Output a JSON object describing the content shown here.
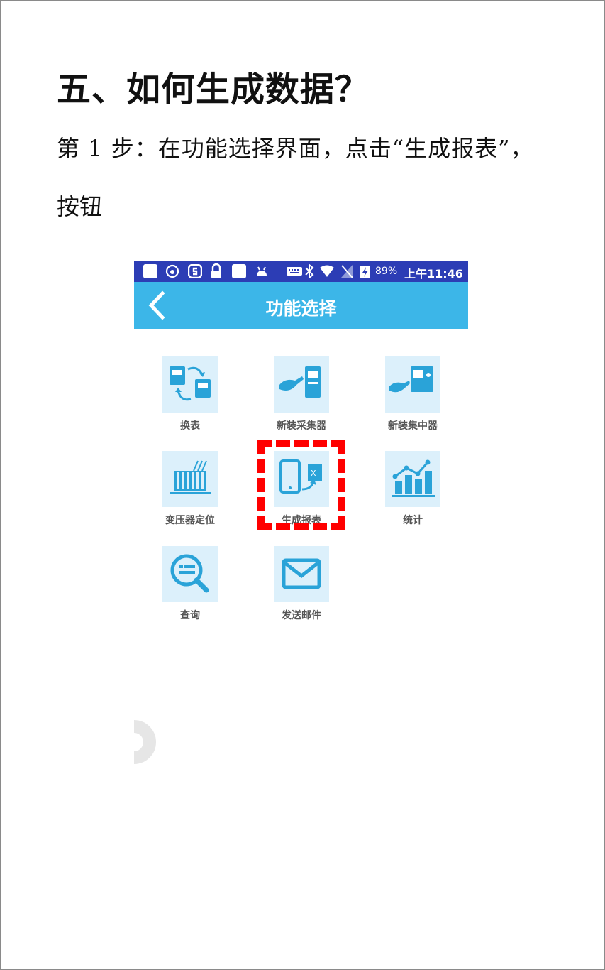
{
  "document": {
    "heading": "五、如何生成数据？",
    "paragraph_line1": "第 1 步：在功能选择界面，点击“生成报表”，",
    "paragraph_line2": "按钮"
  },
  "phone": {
    "status_bar": {
      "battery_percent": "89%",
      "time": "上午11:46",
      "icons": [
        "square-icon",
        "weibo-icon",
        "swiftkey-icon",
        "lock-icon",
        "square-icon",
        "android-icon",
        "keyboard-icon",
        "bluetooth-icon",
        "wifi-icon",
        "no-signal-icon",
        "battery-charging-icon"
      ]
    },
    "title_bar": {
      "title": "功能选择",
      "back_icon": "chevron-left-icon"
    },
    "menu_items": [
      {
        "label": "换表",
        "icon": "meter-swap-icon"
      },
      {
        "label": "新装采集器",
        "icon": "install-collector-icon"
      },
      {
        "label": "新装集中器",
        "icon": "install-concentrator-icon"
      },
      {
        "label": "变压器定位",
        "icon": "transformer-icon"
      },
      {
        "label": "生成报表",
        "icon": "tablet-excel-export-icon"
      },
      {
        "label": "统计",
        "icon": "bar-chart-icon"
      },
      {
        "label": "查询",
        "icon": "search-document-icon"
      },
      {
        "label": "发送邮件",
        "icon": "mail-icon"
      }
    ],
    "highlight_color": "#ff0000",
    "accent_color": "#3cb6e8",
    "status_bar_color": "#2c3db5"
  }
}
